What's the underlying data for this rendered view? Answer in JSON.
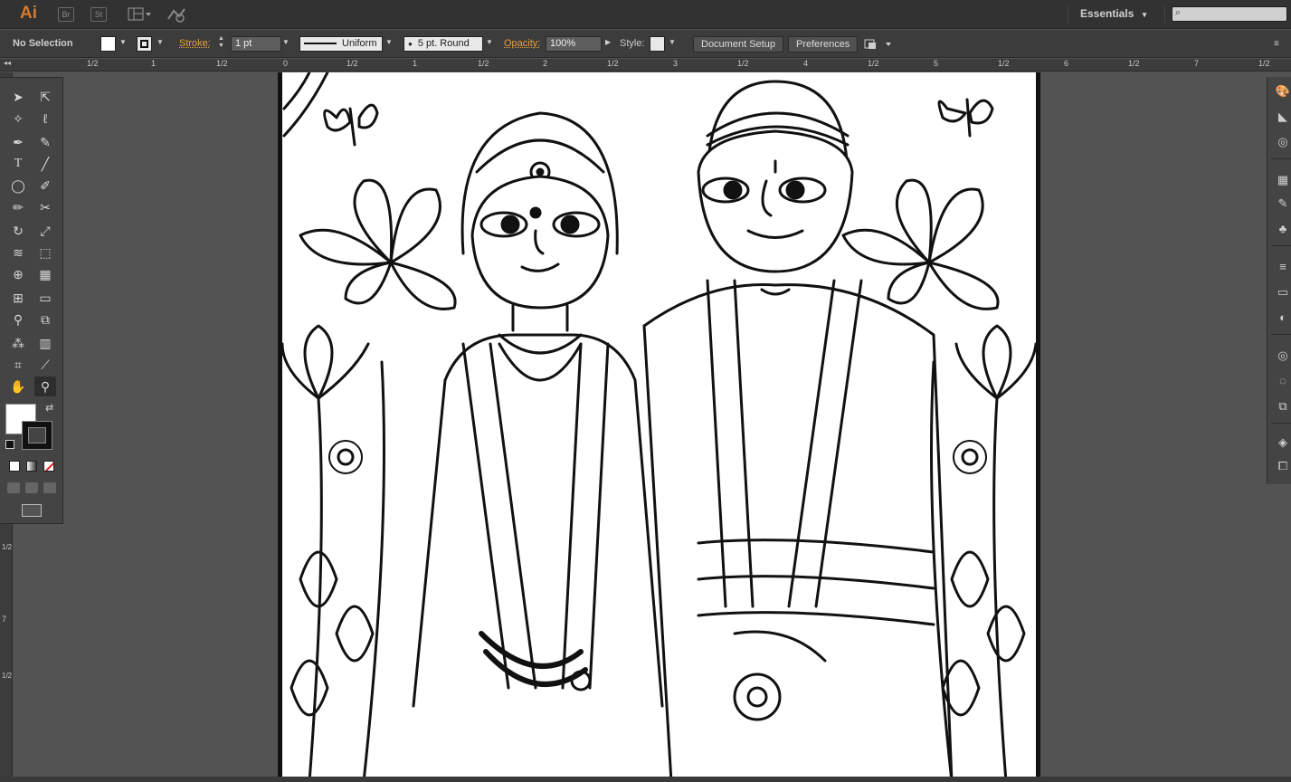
{
  "menubar": {
    "app_logo": "Ai",
    "bridge": "Br",
    "stock": "St",
    "workspace": "Essentials",
    "icons": [
      "arrange-documents-icon",
      "gpu-performance-icon",
      "search-icon"
    ]
  },
  "controlbar": {
    "selection": "No Selection",
    "stroke_label": "Stroke:",
    "stroke_weight": "1 pt",
    "variable_width_profile": "Uniform",
    "brush_definition": "5 pt. Round",
    "opacity_label": "Opacity:",
    "opacity_value": "100%",
    "style_label": "Style:",
    "document_setup": "Document Setup",
    "preferences": "Preferences"
  },
  "ruler_top": {
    "ticks": [
      "1/2",
      "1",
      "1/2",
      "0",
      "1/2",
      "1",
      "1/2",
      "2",
      "1/2",
      "3",
      "1/2",
      "4",
      "1/2",
      "5",
      "1/2",
      "6",
      "1/2",
      "7",
      "1/2"
    ]
  },
  "ruler_left": {
    "ticks": [
      "1/2",
      "7",
      "1/2"
    ]
  },
  "tools": {
    "items": [
      "selection-tool",
      "direct-selection-tool",
      "magic-wand-tool",
      "lasso-tool",
      "pen-tool",
      "curvature-tool",
      "type-tool",
      "line-segment-tool",
      "ellipse-tool",
      "paintbrush-tool",
      "pencil-tool",
      "scissors-tool",
      "rotate-tool",
      "scale-tool",
      "warp-tool",
      "free-transform-tool",
      "shape-builder-tool",
      "perspective-grid-tool",
      "mesh-tool",
      "gradient-tool",
      "eyedropper-tool",
      "blend-tool",
      "symbol-sprayer-tool",
      "column-graph-tool",
      "artboard-tool",
      "slice-tool",
      "hand-tool",
      "zoom-tool"
    ]
  },
  "colors": {
    "accent": "#d57b2e",
    "label_orange": "#e8a043",
    "panel_bg": "#3c3c3c",
    "canvas_bg": "#535353",
    "artboard": "#ffffff"
  },
  "artwork": "Coloring-page illustration of a bride and groom surrounded by flowers, leaves and butterflies"
}
